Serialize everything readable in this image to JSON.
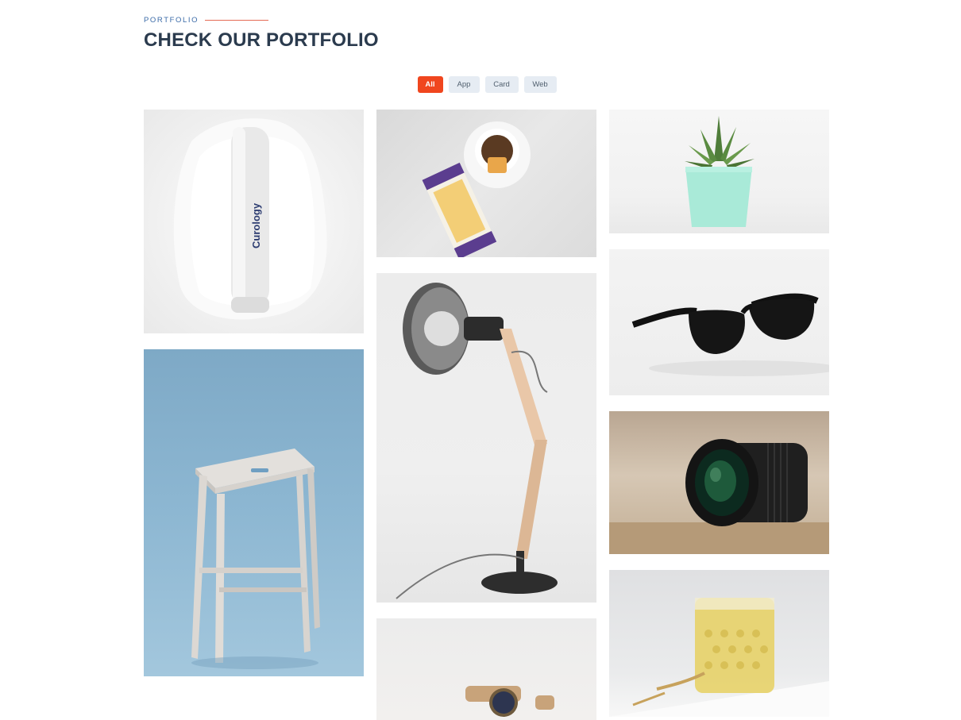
{
  "header": {
    "eyebrow": "PORTFOLIO",
    "title": "CHECK OUR PORTFOLIO"
  },
  "filters": [
    {
      "label": "All",
      "active": true
    },
    {
      "label": "App",
      "active": false
    },
    {
      "label": "Card",
      "active": false
    },
    {
      "label": "Web",
      "active": false
    }
  ],
  "portfolio": {
    "curology_brand": "Curology"
  },
  "colors": {
    "accent": "#f0461e",
    "heading": "#2b3b4e",
    "eyebrow": "#3b6ba8",
    "filter_bg": "#e6ecf3"
  }
}
